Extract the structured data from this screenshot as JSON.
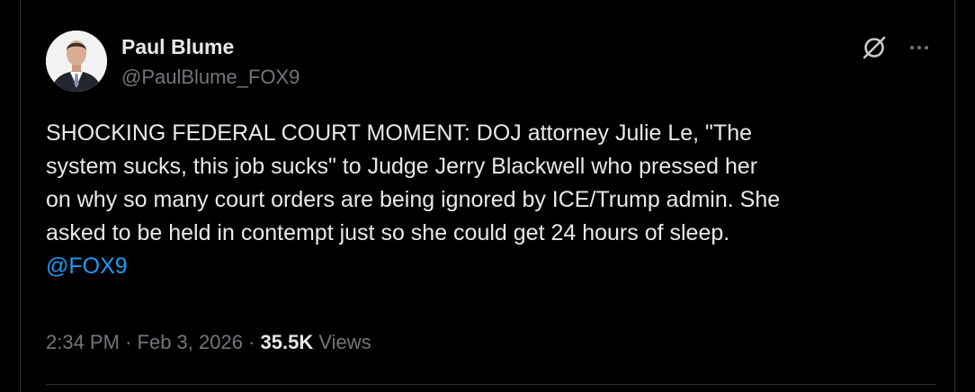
{
  "author": {
    "display_name": "Paul Blume",
    "handle": "@PaulBlume_FOX9"
  },
  "tweet": {
    "text": "SHOCKING FEDERAL COURT MOMENT: DOJ attorney Julie Le, \"The\nsystem sucks, this job sucks\" to Judge Jerry Blackwell who pressed her\non why so many court orders are being ignored by ICE/Trump admin. She\nasked to be held in contempt just so she could get 24 hours of sleep.",
    "mention": "@FOX9"
  },
  "meta": {
    "time": "2:34 PM",
    "separator": "·",
    "date": "Feb 3, 2026",
    "views_count": "35.5K",
    "views_label": "Views"
  },
  "icons": {
    "grok": "grok-icon",
    "more": "more-options-icon"
  },
  "colors": {
    "background": "#000000",
    "text": "#e7e9ea",
    "muted": "#71767b",
    "link": "#1d9bf0"
  }
}
